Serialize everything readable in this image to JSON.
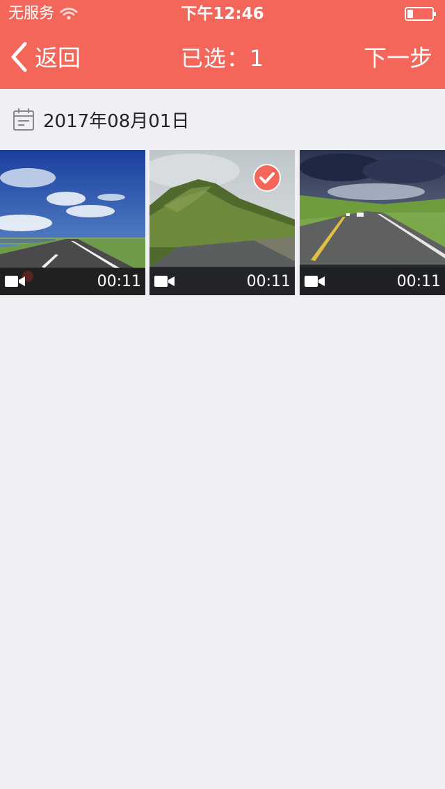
{
  "status_bar": {
    "carrier": "无服务",
    "time": "下午12:46",
    "icons": {
      "wifi": "wifi-icon",
      "battery": "battery-icon"
    }
  },
  "nav": {
    "back_label": "返回",
    "title": "已选：1",
    "next_label": "下一步",
    "icons": {
      "back": "chevron-left-icon"
    }
  },
  "section": {
    "date": "2017年08月01日",
    "icon": "calendar-icon"
  },
  "videos": [
    {
      "duration": "00:11",
      "selected": false,
      "icon": "video-camera-icon"
    },
    {
      "duration": "00:11",
      "selected": true,
      "icon": "video-camera-icon"
    },
    {
      "duration": "00:11",
      "selected": false,
      "icon": "video-camera-icon"
    }
  ],
  "colors": {
    "accent": "#f4665a",
    "background": "#efeff4",
    "header_text": "#ffffff"
  }
}
